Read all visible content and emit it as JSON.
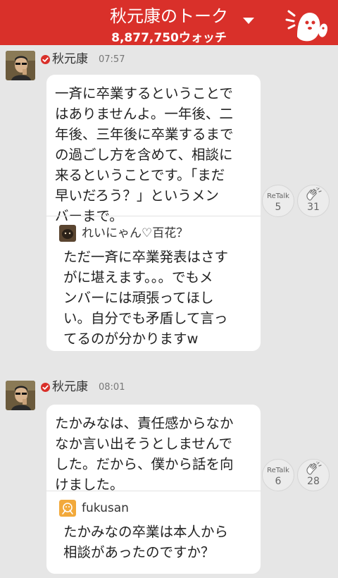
{
  "header": {
    "title": "秋元康のトーク",
    "watch_count": "8,877,750ウォッチ"
  },
  "posts": [
    {
      "author": "秋元康",
      "time": "07:57",
      "text": "一斉に卒業するということで\nはありませんよ。一年後、二\n年後、三年後に卒業するまで\nの過ごし方を含めて、相談に\n来るということです。「まだ\n早いだろう？」というメン\nバーまで。",
      "quote_author": "れいにゃん♡百花？",
      "quote_text": "ただ一斉に卒業発表はさす\nがに堪えます。。。でもメ\nンバーには頑張ってほし\nい。自分でも矛盾して言っ\nてるのが分かりますw",
      "retalk_label": "ReTalk",
      "retalk_count": "5",
      "clap_count": "31"
    },
    {
      "author": "秋元康",
      "time": "08:01",
      "text": "たかみなは、責任感からなか\nなか言い出そうとしませんで\nした。だから、僕から話を向\nけました。",
      "quote_author": "fukusan",
      "quote_text": "たかみなの卒業は本人から\n相談があったのですか？",
      "retalk_label": "ReTalk",
      "retalk_count": "6",
      "clap_count": "28"
    }
  ],
  "colors": {
    "header_bg": "#d9302a",
    "background": "#e6e6e6",
    "bubble": "#ffffff",
    "verified_badge": "#d9302a"
  },
  "icons": [
    "chevron-down-icon",
    "mascot-icon",
    "verified-icon",
    "clap-icon"
  ]
}
